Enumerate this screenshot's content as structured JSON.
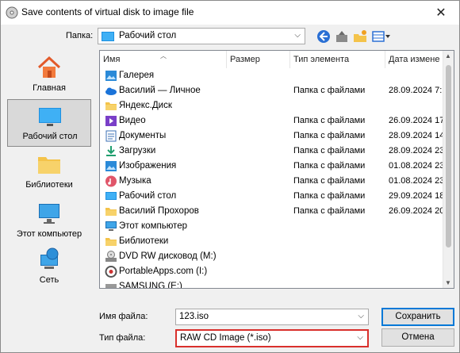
{
  "window": {
    "title": "Save contents of virtual disk to image file",
    "close_label": "✕"
  },
  "lookin": {
    "label": "Папка:",
    "value": "Рабочий стол"
  },
  "places": [
    {
      "label": "Главная",
      "icon": "home-icon"
    },
    {
      "label": "Рабочий стол",
      "icon": "desktop-icon",
      "selected": true
    },
    {
      "label": "Библиотеки",
      "icon": "libraries-icon"
    },
    {
      "label": "Этот компьютер",
      "icon": "computer-icon"
    },
    {
      "label": "Сеть",
      "icon": "network-icon"
    }
  ],
  "columns": {
    "name": "Имя",
    "size": "Размер",
    "type": "Тип элемента",
    "date": "Дата измене"
  },
  "files": [
    {
      "name": "Галерея",
      "type": "",
      "date": "",
      "icon": "gallery-icon"
    },
    {
      "name": "Василий — Личное",
      "type": "Папка с файлами",
      "date": "28.09.2024 7:",
      "icon": "onedrive-icon"
    },
    {
      "name": "Яндекс.Диск",
      "type": "",
      "date": "",
      "icon": "folder-icon"
    },
    {
      "name": "Видео",
      "type": "Папка с файлами",
      "date": "26.09.2024 17",
      "icon": "video-folder-icon"
    },
    {
      "name": "Документы",
      "type": "Папка с файлами",
      "date": "28.09.2024 14",
      "icon": "documents-folder-icon"
    },
    {
      "name": "Загрузки",
      "type": "Папка с файлами",
      "date": "28.09.2024 23",
      "icon": "downloads-folder-icon"
    },
    {
      "name": "Изображения",
      "type": "Папка с файлами",
      "date": "01.08.2024 23",
      "icon": "pictures-folder-icon"
    },
    {
      "name": "Музыка",
      "type": "Папка с файлами",
      "date": "01.08.2024 23",
      "icon": "music-folder-icon"
    },
    {
      "name": "Рабочий стол",
      "type": "Папка с файлами",
      "date": "29.09.2024 18",
      "icon": "desktop-folder-icon"
    },
    {
      "name": "Василий Прохоров",
      "type": "Папка с файлами",
      "date": "26.09.2024 20",
      "icon": "folder-icon"
    },
    {
      "name": "Этот компьютер",
      "type": "",
      "date": "",
      "icon": "computer-icon"
    },
    {
      "name": "Библиотеки",
      "type": "",
      "date": "",
      "icon": "libraries-icon"
    },
    {
      "name": "DVD RW дисковод (M:)",
      "type": "",
      "date": "",
      "icon": "dvd-drive-icon"
    },
    {
      "name": "PortableApps.com (I:)",
      "type": "",
      "date": "",
      "icon": "portableapps-icon"
    },
    {
      "name": "SAMSUNG (E:)",
      "type": "",
      "date": "",
      "icon": "drive-icon"
    }
  ],
  "filename": {
    "label": "Имя файла:",
    "value": "123.iso"
  },
  "filetype": {
    "label": "Тип файла:",
    "value": "RAW CD Image (*.iso)"
  },
  "buttons": {
    "save": "Сохранить",
    "cancel": "Отмена"
  },
  "colors": {
    "accent": "#0078d7",
    "highlight_border": "#d9302c",
    "folder": "#f4c34a"
  }
}
